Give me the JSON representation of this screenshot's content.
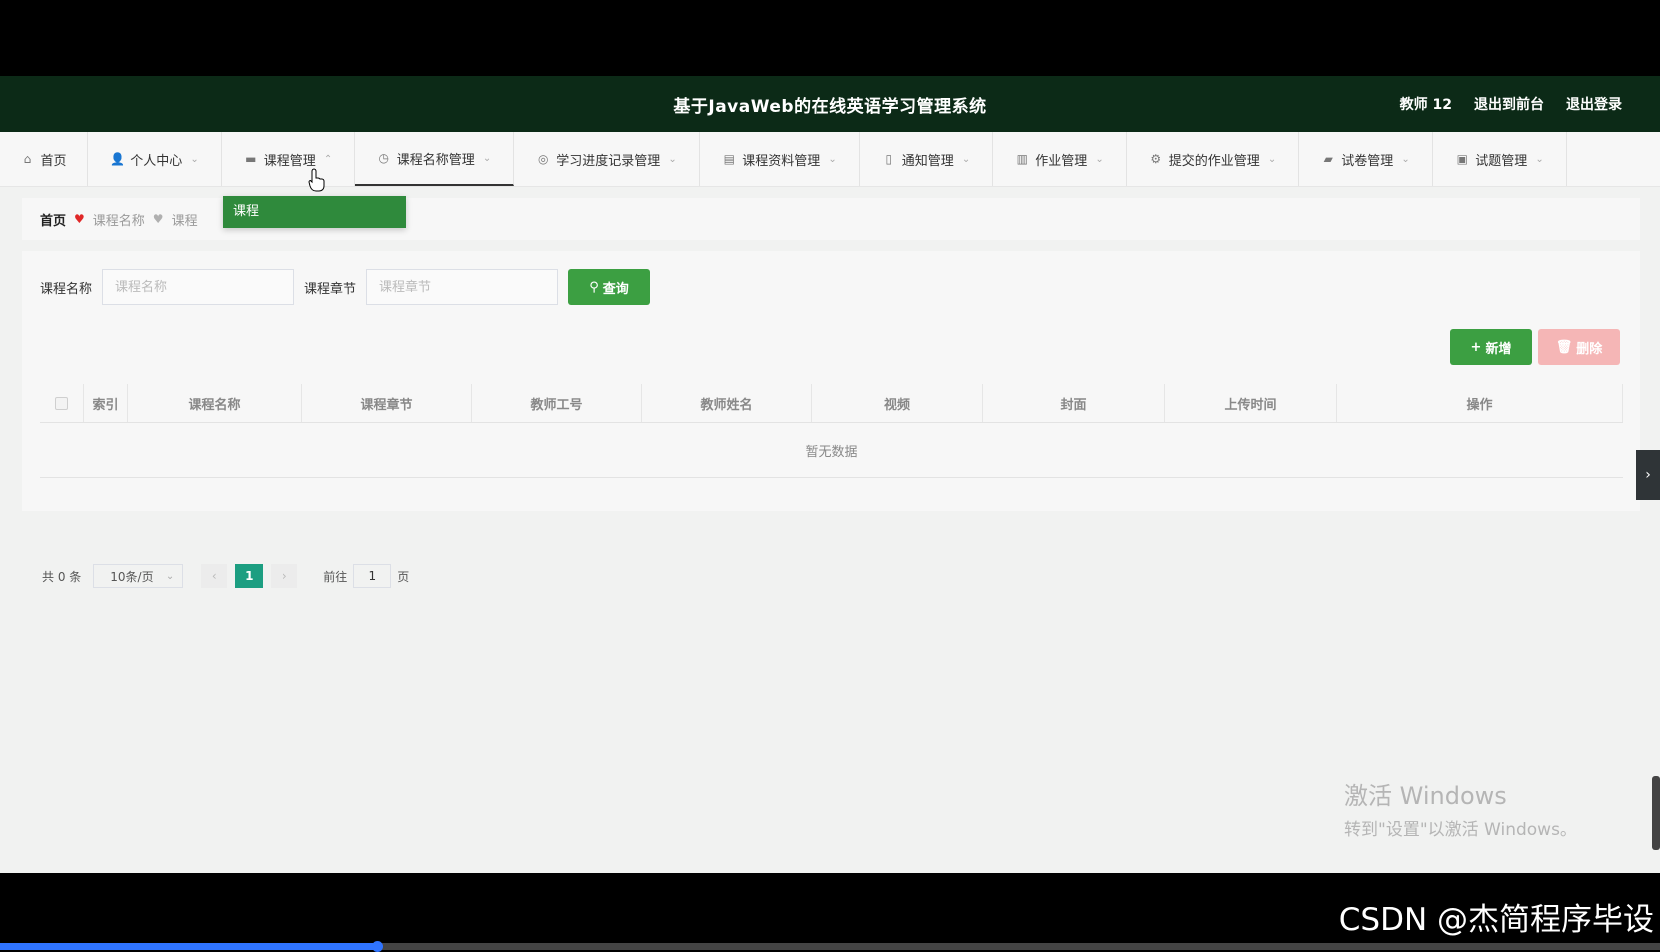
{
  "header": {
    "title": "基于JavaWeb的在线英语学习管理系统",
    "user": "教师 12",
    "links": [
      "退出到前台",
      "退出登录"
    ]
  },
  "nav": [
    {
      "label": "首页",
      "icon": "home-icon",
      "chevron": false
    },
    {
      "label": "个人中心",
      "icon": "user-icon",
      "chevron": true
    },
    {
      "label": "课程管理",
      "icon": "monitor-icon",
      "chevron": true,
      "open": true
    },
    {
      "label": "课程名称管理",
      "icon": "clock-icon",
      "chevron": true,
      "active": true
    },
    {
      "label": "学习进度记录管理",
      "icon": "compass-icon",
      "chevron": true
    },
    {
      "label": "课程资料管理",
      "icon": "briefcase-icon",
      "chevron": true
    },
    {
      "label": "通知管理",
      "icon": "bell-icon",
      "chevron": true
    },
    {
      "label": "作业管理",
      "icon": "bar-chart-icon",
      "chevron": true
    },
    {
      "label": "提交的作业管理",
      "icon": "settings-icon",
      "chevron": true
    },
    {
      "label": "试卷管理",
      "icon": "message-icon",
      "chevron": true
    },
    {
      "label": "试题管理",
      "icon": "clipboard-icon",
      "chevron": true
    }
  ],
  "dropdown": {
    "items": [
      "课程"
    ]
  },
  "breadcrumb": {
    "home": "首页",
    "items": [
      "课程名称",
      "课程"
    ]
  },
  "search": {
    "fields": [
      {
        "label": "课程名称",
        "placeholder": "课程名称",
        "value": ""
      },
      {
        "label": "课程章节",
        "placeholder": "课程章节",
        "value": ""
      }
    ],
    "button": "查询"
  },
  "actions": {
    "add": "新增",
    "delete": "删除"
  },
  "table": {
    "columns": [
      "索引",
      "课程名称",
      "课程章节",
      "教师工号",
      "教师姓名",
      "视频",
      "封面",
      "上传时间",
      "操作"
    ],
    "rows": [],
    "empty_text": "暂无数据"
  },
  "pagination": {
    "total_text": "共 0 条",
    "page_size": "10条/页",
    "current_page": "1",
    "goto_label": "前往",
    "goto_value": "1",
    "page_suffix": "页"
  },
  "watermark": {
    "line1": "激活 Windows",
    "line2": "转到\"设置\"以激活 Windows。"
  },
  "overlay": {
    "csdn": "CSDN @杰简程序毕设"
  },
  "video_progress": 0.227,
  "colors": {
    "header_bg": "#0c2a17",
    "primary_green": "#3c9f42",
    "pager_active": "#1c9e81",
    "delete_disabled": "#f5b6b6"
  }
}
